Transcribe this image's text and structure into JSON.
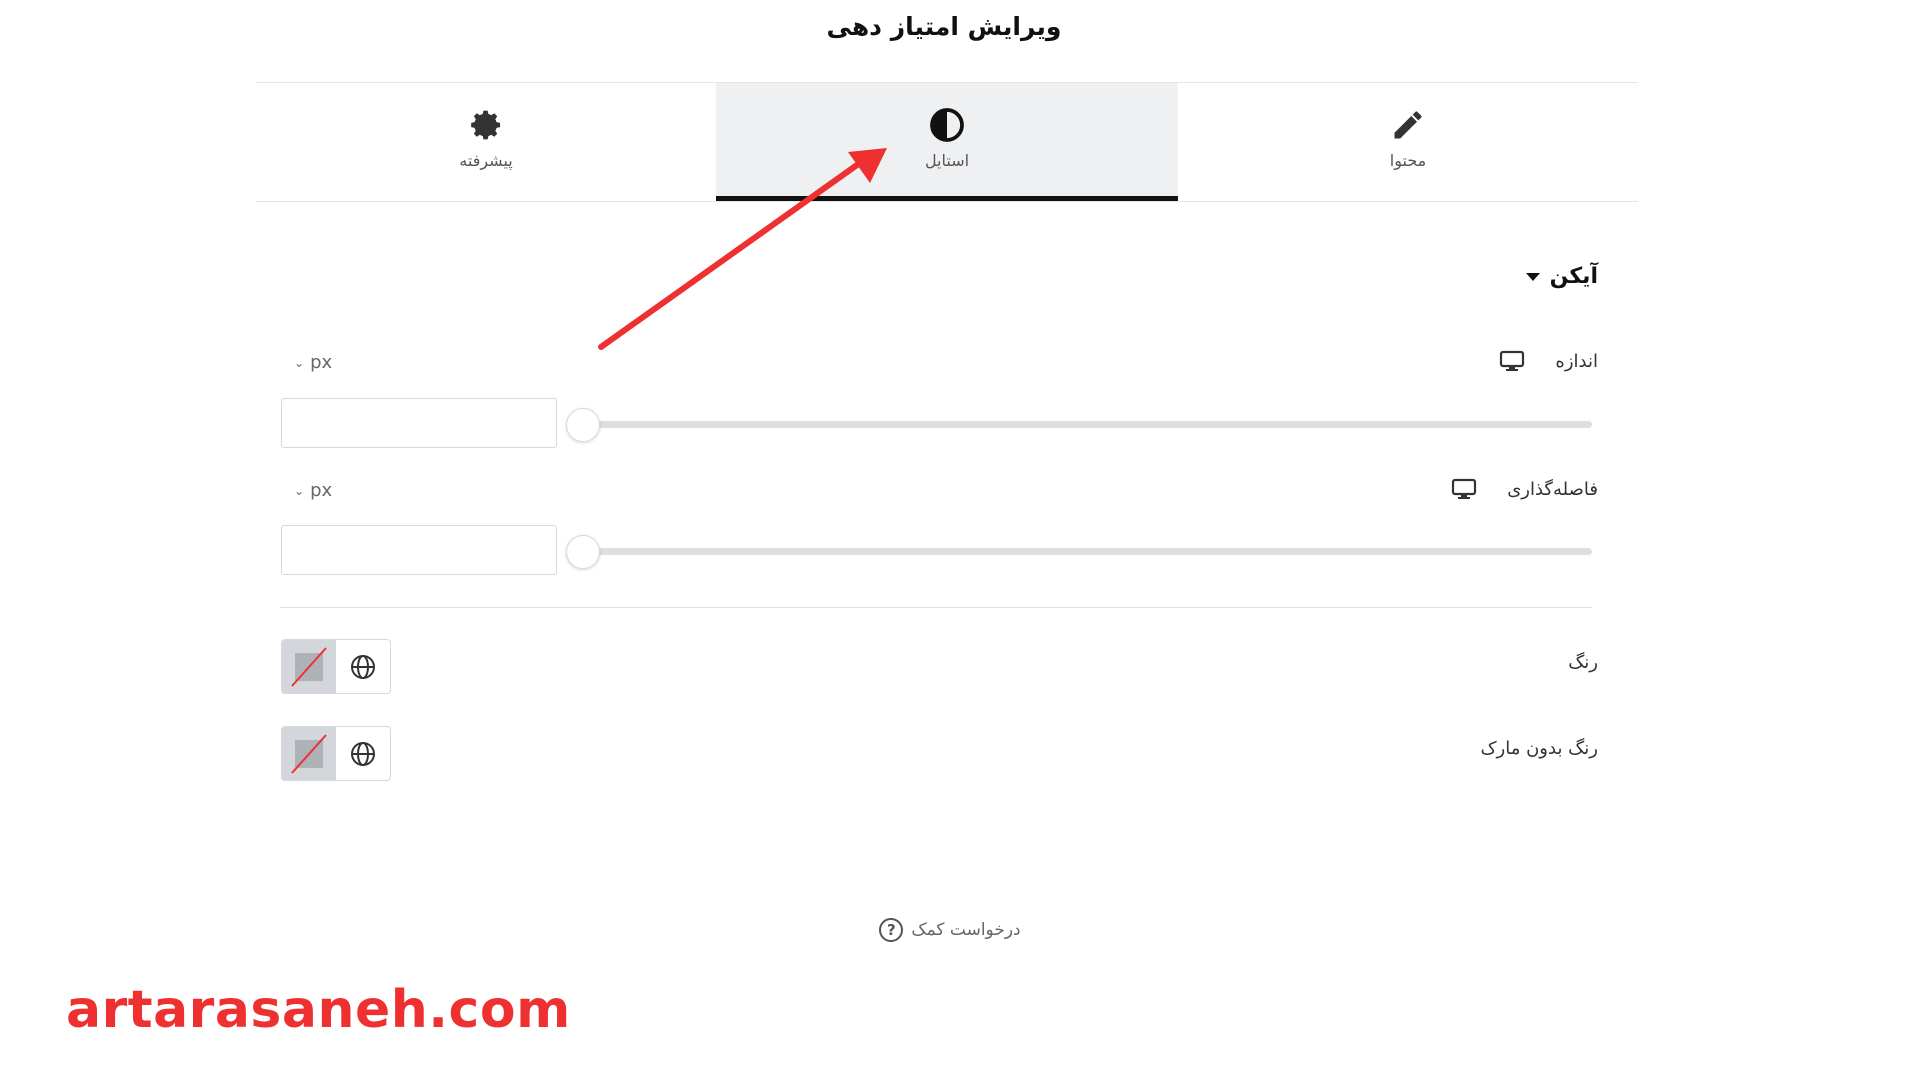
{
  "panel": {
    "title": "ویرایش امتیاز دهی"
  },
  "tabs": [
    {
      "label": "محتوا",
      "icon": "pencil-icon",
      "active": false
    },
    {
      "label": "استایل",
      "icon": "contrast-icon",
      "active": true
    },
    {
      "label": "پیشرفته",
      "icon": "gear-icon",
      "active": false
    }
  ],
  "section": {
    "title": "آیکن",
    "expanded": true
  },
  "controls": {
    "size": {
      "label": "اندازه",
      "unit": "px",
      "value": "",
      "device_icon": "desktop-icon"
    },
    "spacing": {
      "label": "فاصله‌گذاری",
      "unit": "px",
      "value": "",
      "device_icon": "desktop-icon"
    },
    "color": {
      "label": "رنگ"
    },
    "unmarked_color": {
      "label": "رنگ بدون مارک"
    }
  },
  "help": {
    "label": "درخواست کمک"
  },
  "watermark": {
    "text": "artarasaneh.com"
  },
  "colors": {
    "accent": "#111111",
    "arrow": "#ee3030",
    "track": "#dcdee1",
    "active_tab_bg": "#eef0f2"
  }
}
